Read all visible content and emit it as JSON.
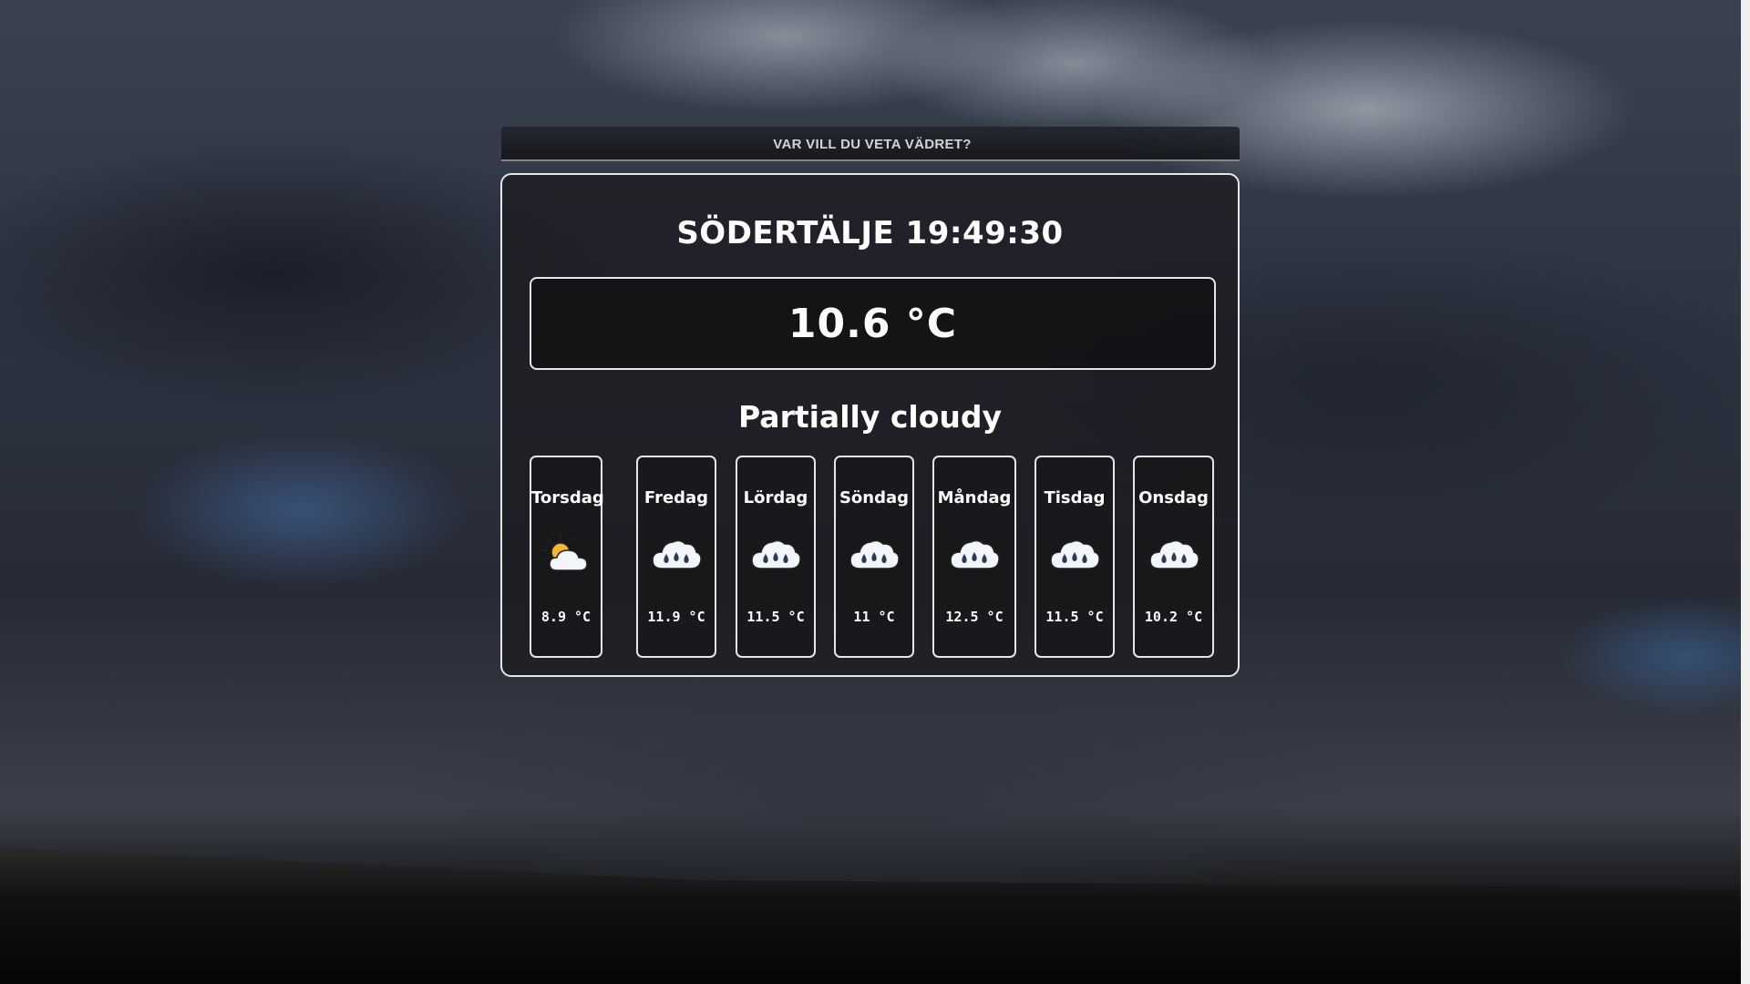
{
  "search": {
    "placeholder": "VAR VILL DU VETA VÄDRET?"
  },
  "current": {
    "city_time": "SÖDERTÄLJE 19:49:30",
    "temperature": "10.6 °C",
    "condition": "Partially cloudy"
  },
  "forecast": [
    {
      "day": "Torsdag",
      "icon": "partly-cloudy-day-icon",
      "temp": "8.9 °C"
    },
    {
      "day": "Fredag",
      "icon": "rain-cloud-icon",
      "temp": "11.9 °C"
    },
    {
      "day": "Lördag",
      "icon": "rain-cloud-icon",
      "temp": "11.5 °C"
    },
    {
      "day": "Söndag",
      "icon": "rain-cloud-icon",
      "temp": "11 °C"
    },
    {
      "day": "Måndag",
      "icon": "rain-cloud-icon",
      "temp": "12.5 °C"
    },
    {
      "day": "Tisdag",
      "icon": "rain-cloud-icon",
      "temp": "11.5 °C"
    },
    {
      "day": "Onsdag",
      "icon": "rain-cloud-icon",
      "temp": "10.2 °C"
    }
  ],
  "colors": {
    "text": "#ffffff",
    "border": "#e6e6e6",
    "sun": "#f5b731",
    "raindrop": "#2a3a55"
  }
}
